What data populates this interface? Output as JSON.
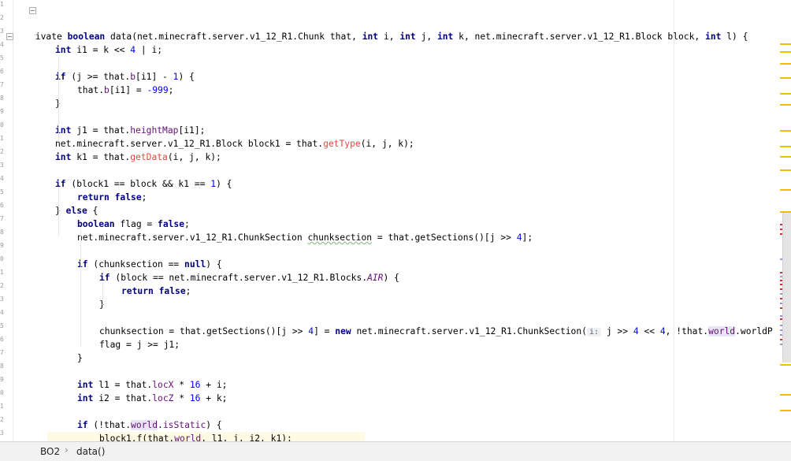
{
  "editor": {
    "gutter_numbers": [
      "1",
      "2",
      "3",
      "4",
      "5",
      "6",
      "7",
      "8",
      "9",
      "0",
      "1",
      "2",
      "3",
      "4",
      "5",
      "6",
      "7",
      "8",
      "9",
      "0",
      "1",
      "2",
      "3",
      "4",
      "5",
      "6",
      "7",
      "8",
      "9",
      "0",
      "1",
      "2",
      "3"
    ],
    "code": [
      {
        "parts": [
          [
            "kw",
            "private"
          ],
          [
            "",
            "rivate "
          ],
          [
            "kw",
            "boolean"
          ],
          [
            "",
            " data(net.minecraft.server.v1_12_R1.Chunk that, "
          ],
          [
            "kw",
            "int"
          ],
          [
            "",
            " i, "
          ],
          [
            "kw",
            "int"
          ],
          [
            "",
            " j, "
          ],
          [
            "kw",
            "int"
          ],
          [
            "",
            " k, net.minecraft.server.v1_12_R1.Block block, "
          ],
          [
            "kw",
            "int"
          ],
          [
            "",
            " l) {"
          ]
        ]
      },
      {
        "parts": [
          [
            "kw",
            "int"
          ],
          [
            "",
            " i1 = k << "
          ],
          [
            "nm",
            "4"
          ],
          [
            "",
            " | i;"
          ]
        ]
      },
      {
        "parts": []
      },
      {
        "parts": [
          [
            "kw",
            "if"
          ],
          [
            "",
            " (j >= that."
          ],
          [
            "fd",
            "b"
          ],
          [
            "",
            "[i1] - "
          ],
          [
            "nm",
            "1"
          ],
          [
            "",
            ") {"
          ]
        ]
      },
      {
        "parts": [
          [
            "",
            "that."
          ],
          [
            "fd",
            "b"
          ],
          [
            "",
            "[i1] = "
          ],
          [
            "nm",
            "-999"
          ],
          [
            "",
            ";"
          ]
        ]
      },
      {
        "parts": [
          [
            "",
            "}"
          ]
        ]
      },
      {
        "parts": []
      },
      {
        "parts": [
          [
            "kw",
            "int"
          ],
          [
            "",
            " j1 = that."
          ],
          [
            "fd",
            "heightMap"
          ],
          [
            "",
            "[i1];"
          ]
        ]
      },
      {
        "parts": [
          [
            "",
            "net.minecraft.server.v1_12_R1.Block block1 = that."
          ],
          [
            "mt",
            "getType"
          ],
          [
            "",
            "(i, j, k);"
          ]
        ]
      },
      {
        "parts": [
          [
            "kw",
            "int"
          ],
          [
            "",
            " k1 = that."
          ],
          [
            "mt",
            "getData"
          ],
          [
            "",
            "(i, j, k);"
          ]
        ]
      },
      {
        "parts": []
      },
      {
        "parts": [
          [
            "kw",
            "if"
          ],
          [
            "",
            " (block1 == block && k1 == "
          ],
          [
            "nm",
            "1"
          ],
          [
            "",
            ") {"
          ]
        ]
      },
      {
        "parts": [
          [
            "kw",
            "return false"
          ],
          [
            "",
            ";"
          ]
        ]
      },
      {
        "parts": [
          [
            "",
            "} "
          ],
          [
            "kw",
            "else"
          ],
          [
            "",
            " {"
          ]
        ]
      },
      {
        "parts": [
          [
            "kw",
            "boolean"
          ],
          [
            "",
            " flag = "
          ],
          [
            "kw",
            "false"
          ],
          [
            "",
            ";"
          ]
        ]
      },
      {
        "parts": [
          [
            "",
            "net.minecraft.server.v1_12_R1.ChunkSection "
          ],
          [
            "wv",
            "chunksection"
          ],
          [
            "",
            " = that.getSections()[j >> "
          ],
          [
            "nm",
            "4"
          ],
          [
            "",
            "];"
          ]
        ]
      },
      {
        "parts": []
      },
      {
        "parts": [
          [
            "kw",
            "if"
          ],
          [
            "",
            " (chunksection == "
          ],
          [
            "kw",
            "null"
          ],
          [
            "",
            ") {"
          ]
        ]
      },
      {
        "parts": [
          [
            "kw",
            "if"
          ],
          [
            "",
            " (block == net.minecraft.server.v1_12_R1.Blocks."
          ],
          [
            "en",
            "AIR"
          ],
          [
            "",
            ") {"
          ]
        ]
      },
      {
        "parts": [
          [
            "kw",
            "return false"
          ],
          [
            "",
            ";"
          ]
        ]
      },
      {
        "parts": [
          [
            "",
            "}"
          ]
        ]
      },
      {
        "parts": []
      },
      {
        "parts": [
          [
            "",
            "chunksection = that.getSections()[j >> "
          ],
          [
            "nm",
            "4"
          ],
          [
            "",
            "] = "
          ],
          [
            "kw",
            "new"
          ],
          [
            "",
            " net.minecraft.server.v1_12_R1.ChunkSection("
          ],
          [
            "hint",
            "i:"
          ],
          [
            "",
            " j >> "
          ],
          [
            "nm",
            "4"
          ],
          [
            "",
            " << "
          ],
          [
            "nm",
            "4"
          ],
          [
            "",
            ", !that."
          ],
          [
            "fd hl",
            "world"
          ],
          [
            "",
            ".worldP"
          ]
        ]
      },
      {
        "parts": [
          [
            "",
            "flag = j >= j1;"
          ]
        ]
      },
      {
        "parts": [
          [
            "",
            "}"
          ]
        ]
      },
      {
        "parts": []
      },
      {
        "parts": [
          [
            "kw",
            "int"
          ],
          [
            "",
            " l1 = that."
          ],
          [
            "fd",
            "locX"
          ],
          [
            "",
            " * "
          ],
          [
            "nm",
            "16"
          ],
          [
            "",
            " + i;"
          ]
        ]
      },
      {
        "parts": [
          [
            "kw",
            "int"
          ],
          [
            "",
            " i2 = that."
          ],
          [
            "fd",
            "locZ"
          ],
          [
            "",
            " * "
          ],
          [
            "nm",
            "16"
          ],
          [
            "",
            " + k;"
          ]
        ]
      },
      {
        "parts": []
      },
      {
        "parts": [
          [
            "kw",
            "if"
          ],
          [
            "",
            " (!that."
          ],
          [
            "fd hl",
            "world"
          ],
          [
            "",
            "."
          ],
          [
            "fd",
            "isStatic"
          ],
          [
            "",
            ") {"
          ]
        ]
      },
      {
        "parts": [
          [
            "",
            "block1.f(that."
          ],
          [
            "fd",
            "world"
          ],
          [
            "",
            ", l1, j, i2, k1);"
          ]
        ]
      }
    ]
  },
  "status_bar": {
    "file": "BO2",
    "separator": "›",
    "method": "data()"
  },
  "colors": {
    "keyword": "#000080",
    "field": "#660e7a",
    "method_call": "#e0483d",
    "number": "#0000ff",
    "warning_marker": "#f0c000",
    "error_marker": "#d03030",
    "info_marker": "#a890e0"
  }
}
